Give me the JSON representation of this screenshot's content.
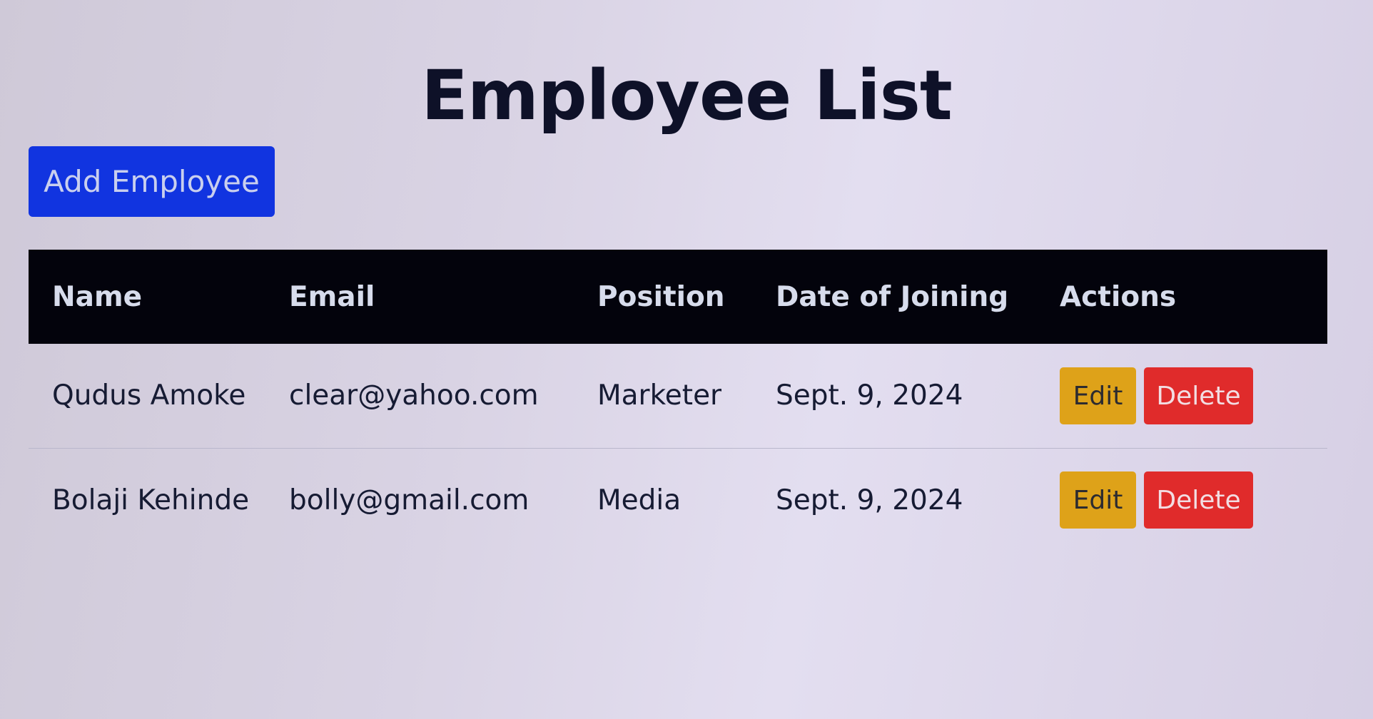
{
  "page": {
    "title": "Employee List",
    "add_button_label": "Add Employee"
  },
  "table": {
    "headers": [
      "Name",
      "Email",
      "Position",
      "Date of Joining",
      "Actions"
    ],
    "rows": [
      {
        "name": "Qudus Amoke",
        "email": "clear@yahoo.com",
        "position": "Marketer",
        "date_of_joining": "Sept. 9, 2024",
        "edit_label": "Edit",
        "delete_label": "Delete"
      },
      {
        "name": "Bolaji Kehinde",
        "email": "bolly@gmail.com",
        "position": "Media",
        "date_of_joining": "Sept. 9, 2024",
        "edit_label": "Edit",
        "delete_label": "Delete"
      }
    ]
  },
  "colors": {
    "add_button": "#1134e0",
    "header_bg": "#03030c",
    "edit_button": "#dea219",
    "delete_button": "#e02b2b"
  }
}
